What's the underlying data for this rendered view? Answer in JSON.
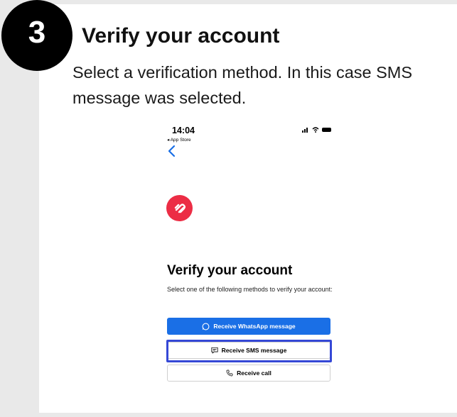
{
  "step": {
    "number": "3",
    "title": "Verify your account",
    "description": "Select a verification method. In this case SMS message was selected."
  },
  "phone": {
    "time": "14:04",
    "back_app": "◂ App Store",
    "screen": {
      "title": "Verify your account",
      "description": "Select one of the following methods to verify your account:",
      "buttons": {
        "whatsapp": "Receive WhatsApp message",
        "sms": "Receive SMS message",
        "call": "Receive call"
      }
    }
  },
  "colors": {
    "primary_button": "#1a6fe6",
    "logo": "#ec2d45",
    "highlight": "#3548d6"
  }
}
